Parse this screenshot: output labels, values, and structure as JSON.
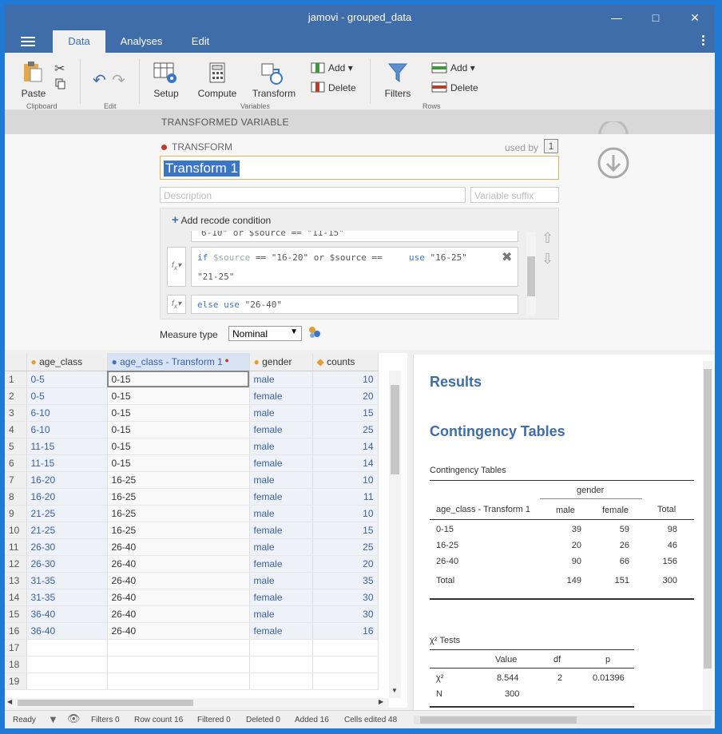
{
  "window": {
    "title": "jamovi - grouped_data"
  },
  "tabs": [
    "Data",
    "Analyses",
    "Edit"
  ],
  "ribbon": {
    "paste": "Paste",
    "clipboard": "Clipboard",
    "edit": "Edit",
    "setup": "Setup",
    "compute": "Compute",
    "transform": "Transform",
    "add": "Add",
    "delete": "Delete",
    "variables": "Variables",
    "filters": "Filters",
    "rows_add": "Add",
    "rows_delete": "Delete",
    "rows": "Rows"
  },
  "editor": {
    "header": "TRANSFORMED VARIABLE",
    "label": "TRANSFORM",
    "used_by": "used by",
    "used_by_count": "1",
    "name": "Transform 1",
    "description_ph": "Description",
    "suffix_ph": "Variable suffix",
    "add_condition": "Add recode condition",
    "cond_prev": "6-10\" or $source == \"11-15\"",
    "cond1_if": "if",
    "cond1_src": "$source",
    "cond1_expr": "== \"16-20\" or $source ==",
    "cond1_expr2": "\"21-25\"",
    "cond1_use": "use",
    "cond1_val": "\"16-25\"",
    "cond2_else": "else use",
    "cond2_val": "\"26-40\"",
    "measure_label": "Measure type",
    "measure_value": "Nominal"
  },
  "grid": {
    "columns": [
      "age_class",
      "age_class - Transform 1",
      "gender",
      "counts"
    ],
    "rows": [
      [
        "1",
        "0-5",
        "0-15",
        "male",
        "10"
      ],
      [
        "2",
        "0-5",
        "0-15",
        "female",
        "20"
      ],
      [
        "3",
        "6-10",
        "0-15",
        "male",
        "15"
      ],
      [
        "4",
        "6-10",
        "0-15",
        "female",
        "25"
      ],
      [
        "5",
        "11-15",
        "0-15",
        "male",
        "14"
      ],
      [
        "6",
        "11-15",
        "0-15",
        "female",
        "14"
      ],
      [
        "7",
        "16-20",
        "16-25",
        "male",
        "10"
      ],
      [
        "8",
        "16-20",
        "16-25",
        "female",
        "11"
      ],
      [
        "9",
        "21-25",
        "16-25",
        "male",
        "10"
      ],
      [
        "10",
        "21-25",
        "16-25",
        "female",
        "15"
      ],
      [
        "11",
        "26-30",
        "26-40",
        "male",
        "25"
      ],
      [
        "12",
        "26-30",
        "26-40",
        "female",
        "20"
      ],
      [
        "13",
        "31-35",
        "26-40",
        "male",
        "35"
      ],
      [
        "14",
        "31-35",
        "26-40",
        "female",
        "30"
      ],
      [
        "15",
        "36-40",
        "26-40",
        "male",
        "30"
      ],
      [
        "16",
        "36-40",
        "26-40",
        "female",
        "16"
      ]
    ],
    "empty_rows": [
      "17",
      "18",
      "19"
    ]
  },
  "status": {
    "ready": "Ready",
    "filters": "Filters 0",
    "rowcount": "Row count 16",
    "filtered": "Filtered 0",
    "deleted": "Deleted 0",
    "added": "Added 16",
    "edited": "Cells edited 48"
  },
  "results": {
    "title": "Results",
    "section": "Contingency Tables",
    "table_title": "Contingency Tables",
    "group": "gender",
    "row_header": "age_class - Transform 1",
    "cols": [
      "male",
      "female",
      "Total"
    ],
    "rows": [
      [
        "0-15",
        "39",
        "59",
        "98"
      ],
      [
        "16-25",
        "20",
        "26",
        "46"
      ],
      [
        "26-40",
        "90",
        "66",
        "156"
      ]
    ],
    "total": [
      "Total",
      "149",
      "151",
      "300"
    ],
    "chi_title": "χ² Tests",
    "chi_cols": [
      "Value",
      "df",
      "p"
    ],
    "chi_row": [
      "χ²",
      "8.544",
      "2",
      "0.01396"
    ],
    "n_row": [
      "N",
      "300"
    ]
  }
}
